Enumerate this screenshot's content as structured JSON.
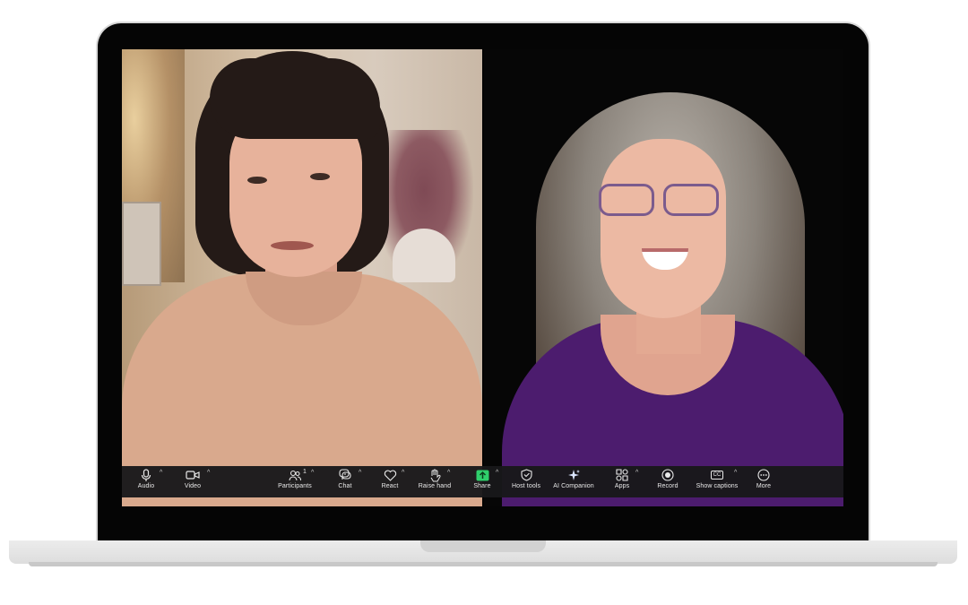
{
  "toolbar": {
    "audio": "Audio",
    "video": "Video",
    "participants": "Participants",
    "participants_count": "1",
    "chat": "Chat",
    "react": "React",
    "raise_hand": "Raise hand",
    "share": "Share",
    "host_tools": "Host tools",
    "ai_companion": "AI Companion",
    "apps": "Apps",
    "record": "Record",
    "show_captions": "Show captions",
    "more": "More",
    "caret": "^",
    "captions_badge": "CC"
  },
  "colors": {
    "toolbar_bg": "#18181a",
    "share_green": "#2fcf6b",
    "toolbar_text": "#e9e9e9"
  },
  "icons": [
    "microphone-icon",
    "camera-icon",
    "participants-icon",
    "chat-icon",
    "heart-icon",
    "hand-icon",
    "share-arrow-icon",
    "shield-icon",
    "sparkle-icon",
    "apps-icon",
    "record-icon",
    "captions-icon",
    "more-icon"
  ]
}
